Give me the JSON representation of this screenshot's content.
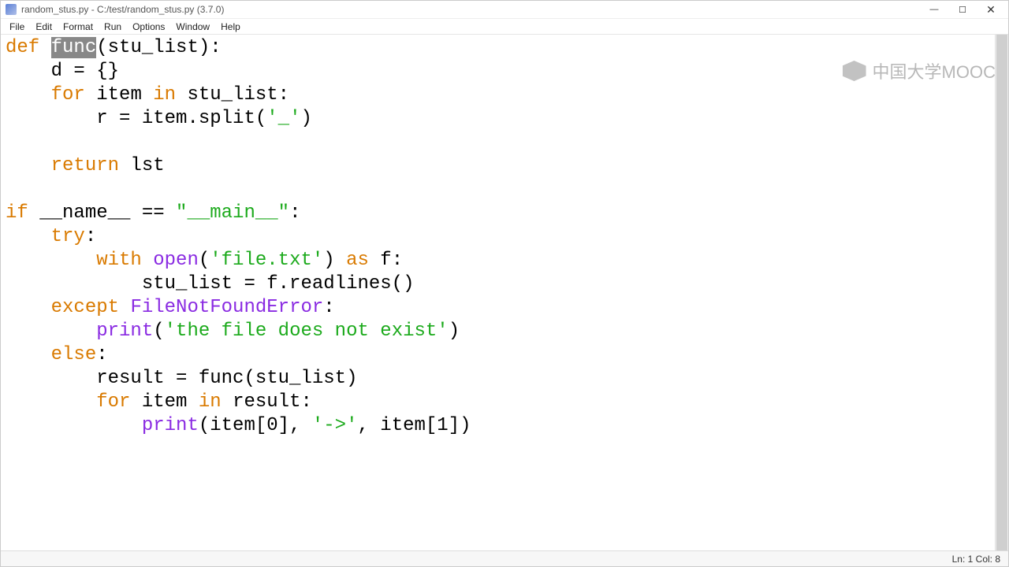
{
  "title": "random_stus.py - C:/test/random_stus.py (3.7.0)",
  "window_controls": {
    "min": "—",
    "max": "☐",
    "close": "✕"
  },
  "menu": [
    "File",
    "Edit",
    "Format",
    "Run",
    "Options",
    "Window",
    "Help"
  ],
  "status": {
    "line_col": "Ln: 1  Col: 8"
  },
  "watermark": "中国大学MOOC",
  "selection": "func",
  "code": {
    "l01_def": "def",
    "l01_func": "func",
    "l01_rest": "(stu_list):",
    "l02": "    d = {}",
    "l03_for": "for",
    "l03_mid": " item ",
    "l03_in": "in",
    "l03_rest": " stu_list:",
    "l04": "        r = item.split(",
    "l04_str": "'_'",
    "l04_end": ")",
    "l06_ret": "return",
    "l06_rest": " lst",
    "l08_if": "if",
    "l08_mid": " __name__ == ",
    "l08_str": "\"__main__\"",
    "l08_end": ":",
    "l09_try": "try",
    "l09_end": ":",
    "l10_with": "with",
    "l10_sp": " ",
    "l10_open": "open",
    "l10_p1": "(",
    "l10_str": "'file.txt'",
    "l10_p2": ") ",
    "l10_as": "as",
    "l10_end": " f:",
    "l11": "            stu_list = f.readlines()",
    "l12_exc": "except",
    "l12_sp": " ",
    "l12_err": "FileNotFoundError",
    "l12_end": ":",
    "l13_sp": "        ",
    "l13_print": "print",
    "l13_p1": "(",
    "l13_str": "'the file does not exist'",
    "l13_end": ")",
    "l14_else": "else",
    "l14_end": ":",
    "l15": "        result = func(stu_list)",
    "l16_sp": "        ",
    "l16_for": "for",
    "l16_mid": " item ",
    "l16_in": "in",
    "l16_end": " result:",
    "l17_sp": "            ",
    "l17_print": "print",
    "l17_p1": "(item[0], ",
    "l17_str": "'->'",
    "l17_end": ", item[1])"
  }
}
